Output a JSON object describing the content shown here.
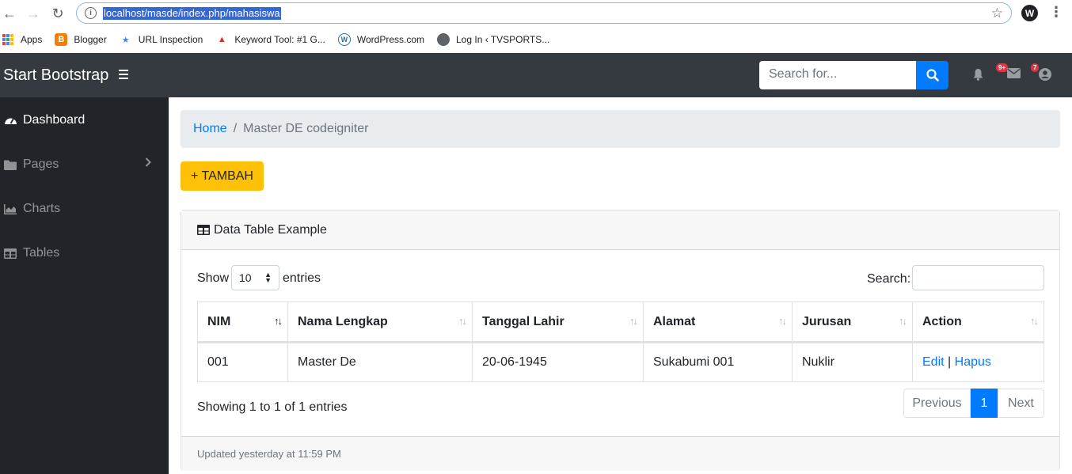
{
  "browser": {
    "url": "localhost/masde/index.php/mahasiswa",
    "bookmarks": [
      {
        "label": "Apps",
        "icon": "apps-grid-icon"
      },
      {
        "label": "Blogger",
        "icon": "blogger-icon"
      },
      {
        "label": "URL Inspection",
        "icon": "url-inspection-icon"
      },
      {
        "label": "Keyword Tool: #1 G...",
        "icon": "keyword-tool-icon"
      },
      {
        "label": "WordPress.com",
        "icon": "wordpress-icon"
      },
      {
        "label": "Log In ‹ TVSPORTS...",
        "icon": "globe-icon"
      }
    ]
  },
  "navbar": {
    "brand": "Start Bootstrap",
    "search_placeholder": "Search for...",
    "alerts_badge": "9+",
    "messages_badge": "7",
    "colors": {
      "bg": "#343a40",
      "primary": "#007bff",
      "danger": "#dc3545"
    }
  },
  "sidebar": {
    "items": [
      {
        "label": "Dashboard",
        "icon": "tachometer-icon",
        "active": true
      },
      {
        "label": "Pages",
        "icon": "folder-icon",
        "active": false
      },
      {
        "label": "Charts",
        "icon": "area-chart-icon",
        "active": false
      },
      {
        "label": "Tables",
        "icon": "table-icon",
        "active": false
      }
    ]
  },
  "breadcrumb": {
    "home": "Home",
    "separator": "/",
    "current": "Master DE codeigniter"
  },
  "actions": {
    "add_label": "+ TAMBAH",
    "add_color": "#ffc107"
  },
  "card": {
    "title": "Data Table Example",
    "show_label": "Show",
    "page_length": "10",
    "entries_label": "entries",
    "search_label": "Search:",
    "columns": [
      "NIM",
      "Nama Lengkap",
      "Tanggal Lahir",
      "Alamat",
      "Jurusan",
      "Action"
    ],
    "rows": [
      {
        "nim": "001",
        "nama": "Master De",
        "tanggal": "20-06-1945",
        "alamat": "Sukabumi 001",
        "jurusan": "Nuklir",
        "edit": "Edit",
        "sep": "|",
        "hapus": "Hapus"
      }
    ],
    "info": "Showing 1 to 1 of 1 entries",
    "pagination": {
      "previous": "Previous",
      "current": "1",
      "next": "Next"
    },
    "footer": "Updated yesterday at 11:59 PM"
  }
}
